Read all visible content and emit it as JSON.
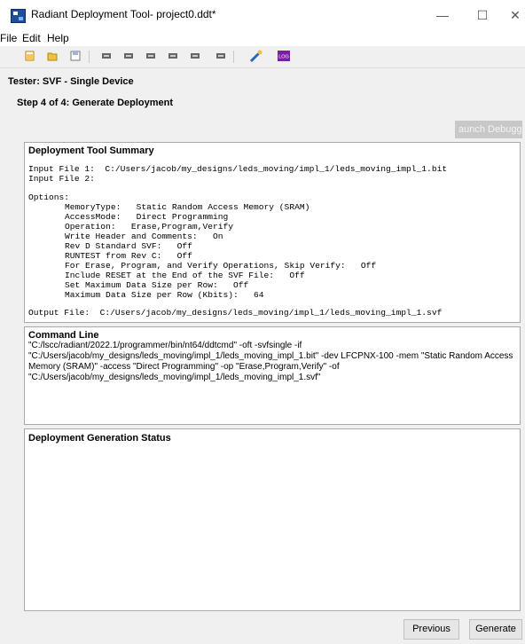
{
  "window": {
    "title": "Radiant Deployment Tool- project0.ddt*",
    "minimize": "—",
    "maximize": "☐",
    "close": "✕"
  },
  "menu": [
    "File",
    "Edit",
    "Help"
  ],
  "toolbar": {
    "icons": [
      "new-icon",
      "open-icon",
      "save-icon",
      "device-icon",
      "device-icon",
      "device-icon",
      "device-icon",
      "device-icon",
      "device-icon",
      "wizard-icon",
      "log-icon"
    ],
    "log_label": "LOG"
  },
  "tester_label": "Tester: SVF - Single Device",
  "step_label": "Step 4 of 4: Generate Deployment",
  "launch_debugger_label": "aunch Debugge",
  "summary": {
    "title": "Deployment Tool Summary",
    "input_file_1": "Input File 1:  C:/Users/jacob/my_designs/leds_moving/impl_1/leds_moving_impl_1.bit",
    "input_file_2": "Input File 2:",
    "options_label": "Options:",
    "options": [
      "MemoryType:   Static Random Access Memory (SRAM)",
      "AccessMode:   Direct Programming",
      "Operation:   Erase,Program,Verify",
      "Write Header and Comments:   On",
      "Rev D Standard SVF:   Off",
      "RUNTEST from Rev C:   Off",
      "For Erase, Program, and Verify Operations, Skip Verify:   Off",
      "Include RESET at the End of the SVF File:   Off",
      "Set Maximum Data Size per Row:   Off",
      "Maximum Data Size per Row (Kbits):   64"
    ],
    "output_file": "Output File:  C:/Users/jacob/my_designs/leds_moving/impl_1/leds_moving_impl_1.svf"
  },
  "command_line": {
    "title": "Command Line",
    "text": "\"C:/lscc/radiant/2022.1/programmer/bin/nt64/ddtcmd\" -oft -svfsingle -if \"C:/Users/jacob/my_designs/leds_moving/impl_1/leds_moving_impl_1.bit\" -dev LFCPNX-100 -mem \"Static Random Access Memory (SRAM)\" -access \"Direct Programming\" -op \"Erase,Program,Verify\" -of \"C:/Users/jacob/my_designs/leds_moving/impl_1/leds_moving_impl_1.svf\""
  },
  "status": {
    "title": "Deployment Generation Status"
  },
  "buttons": {
    "previous": "Previous",
    "generate": "Generate"
  }
}
